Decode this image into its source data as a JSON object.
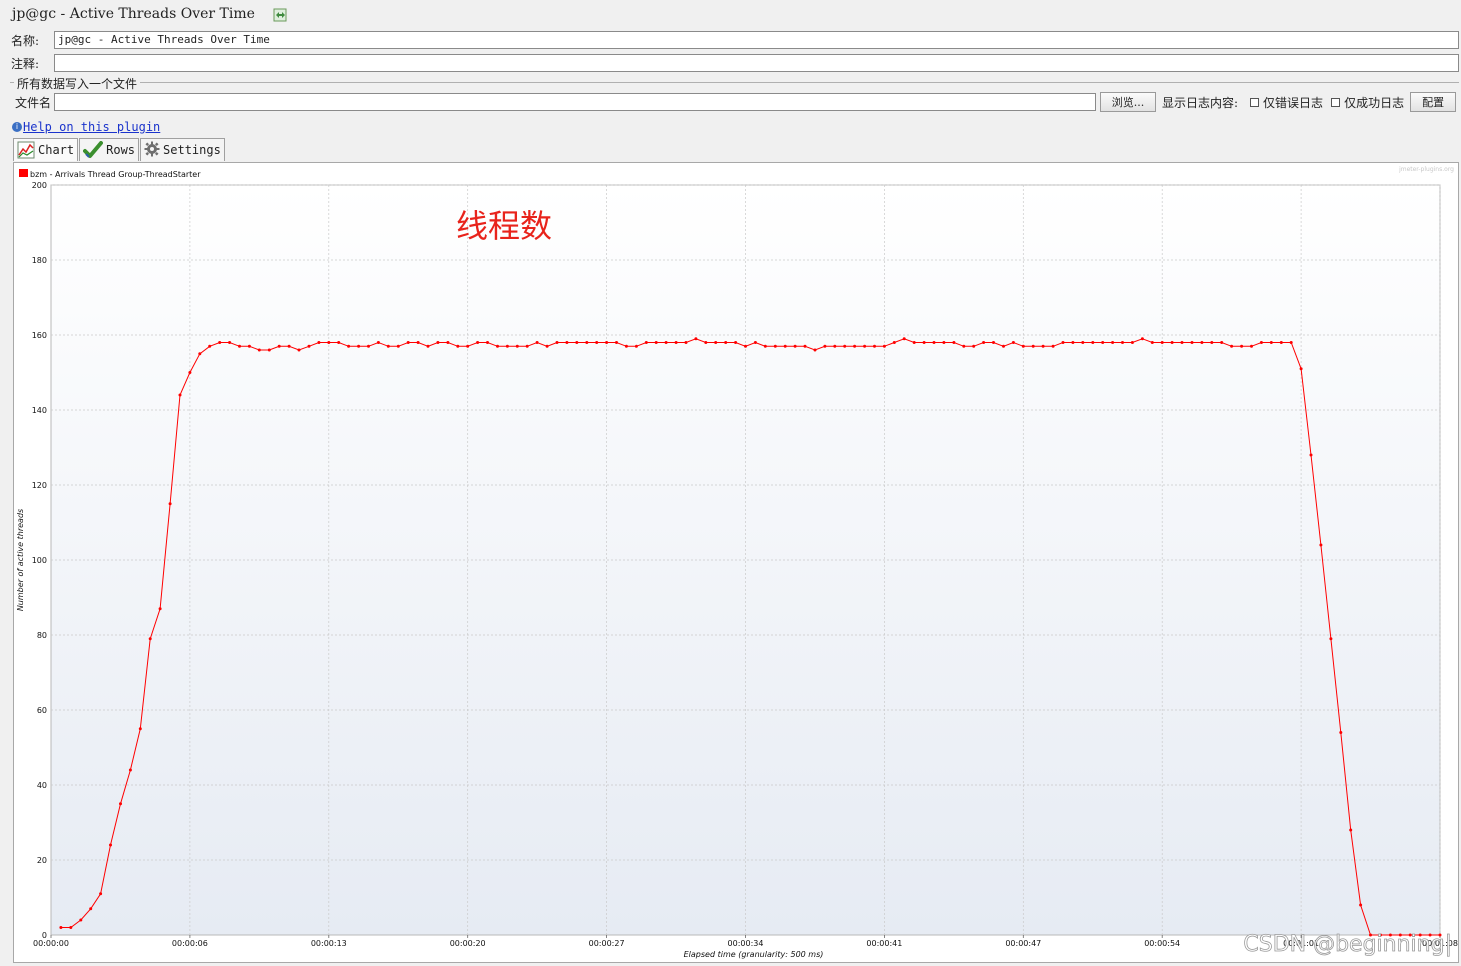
{
  "window": {
    "title": "jp@gc - Active Threads Over Time"
  },
  "form": {
    "name_label": "名称:",
    "name_value": "jp@gc - Active Threads Over Time",
    "comment_label": "注释:",
    "comment_value": ""
  },
  "file_group": {
    "legend": "所有数据写入一个文件",
    "filename_label": "文件名",
    "filename_value": "",
    "browse_button": "浏览...",
    "log_display_label": "显示日志内容:",
    "errors_only_label": "仅错误日志",
    "errors_only_checked": false,
    "success_only_label": "仅成功日志",
    "success_only_checked": false,
    "configure_button": "配置"
  },
  "help": {
    "link_text": "Help on this plugin"
  },
  "tabs": [
    {
      "label": "Chart",
      "icon": "line-chart-icon",
      "active": true
    },
    {
      "label": "Rows",
      "icon": "checkmark-icon",
      "active": false
    },
    {
      "label": "Settings",
      "icon": "gear-icon",
      "active": false
    }
  ],
  "annotation": {
    "text": "线程数",
    "color": "#e8231b"
  },
  "watermark": {
    "text": "CSDN @beginning|"
  },
  "chart_data": {
    "type": "line",
    "title": "",
    "watermark_small": "jmeter-plugins.org",
    "legend": [
      "bzm - Arrivals Thread Group-ThreadStarter"
    ],
    "legend_position": "top-left",
    "xlabel": "Elapsed time (granularity: 500 ms)",
    "ylabel": "Number of active threads",
    "ylim": [
      0,
      200
    ],
    "xlim_seconds": [
      0,
      70
    ],
    "y_ticks": [
      "0",
      "20",
      "40",
      "60",
      "80",
      "100",
      "120",
      "140",
      "160",
      "180",
      "200"
    ],
    "x_ticks": [
      "00:00:00",
      "00:00:06",
      "00:00:13",
      "00:00:20",
      "00:00:27",
      "00:00:34",
      "00:00:41",
      "00:00:47",
      "00:00:54",
      "00:01:01",
      "00:01:08"
    ],
    "grid": true,
    "series_color": "#ff0000",
    "series": [
      {
        "name": "bzm - Arrivals Thread Group-ThreadStarter",
        "x_seconds": [
          0.5,
          1,
          1.5,
          2,
          2.5,
          3,
          3.5,
          4,
          4.5,
          5,
          5.5,
          6,
          6.5,
          7,
          7.5,
          8,
          8.5,
          9,
          9.5,
          10,
          10.5,
          11,
          11.5,
          12,
          12.5,
          13,
          13.5,
          14,
          14.5,
          15,
          15.5,
          16,
          16.5,
          17,
          17.5,
          18,
          18.5,
          19,
          19.5,
          20,
          20.5,
          21,
          21.5,
          22,
          22.5,
          23,
          23.5,
          24,
          24.5,
          25,
          25.5,
          26,
          26.5,
          27,
          27.5,
          28,
          28.5,
          29,
          29.5,
          30,
          30.5,
          31,
          31.5,
          32,
          32.5,
          33,
          33.5,
          34,
          34.5,
          35,
          35.5,
          36,
          36.5,
          37,
          37.5,
          38,
          38.5,
          39,
          39.5,
          40,
          40.5,
          41,
          41.5,
          42,
          42.5,
          43,
          43.5,
          44,
          44.5,
          45,
          45.5,
          46,
          46.5,
          47,
          47.5,
          48,
          48.5,
          49,
          49.5,
          50,
          50.5,
          51,
          51.5,
          52,
          52.5,
          53,
          53.5,
          54,
          54.5,
          55,
          55.5,
          56,
          56.5,
          57,
          57.5,
          58,
          58.5,
          59,
          59.5,
          60,
          60.5,
          61,
          61.5,
          62,
          62.5,
          63,
          63.5,
          64,
          64.5,
          65,
          65.5,
          66,
          66.5,
          67,
          67.5,
          68,
          68.5,
          69,
          69.5,
          70
        ],
        "values": [
          2,
          2,
          4,
          7,
          11,
          24,
          35,
          44,
          55,
          79,
          87,
          115,
          144,
          150,
          155,
          157,
          158,
          158,
          157,
          157,
          156,
          156,
          157,
          157,
          156,
          157,
          158,
          158,
          158,
          157,
          157,
          157,
          158,
          157,
          157,
          158,
          158,
          157,
          158,
          158,
          157,
          157,
          158,
          158,
          157,
          157,
          157,
          157,
          158,
          157,
          158,
          158,
          158,
          158,
          158,
          158,
          158,
          157,
          157,
          158,
          158,
          158,
          158,
          158,
          159,
          158,
          158,
          158,
          158,
          157,
          158,
          157,
          157,
          157,
          157,
          157,
          156,
          157,
          157,
          157,
          157,
          157,
          157,
          157,
          158,
          159,
          158,
          158,
          158,
          158,
          158,
          157,
          157,
          158,
          158,
          157,
          158,
          157,
          157,
          157,
          157,
          158,
          158,
          158,
          158,
          158,
          158,
          158,
          158,
          159,
          158,
          158,
          158,
          158,
          158,
          158,
          158,
          158,
          157,
          157,
          157,
          158,
          158,
          158,
          158,
          151,
          128,
          104,
          79,
          54,
          28,
          8,
          0,
          0,
          0,
          0,
          0,
          0,
          0,
          0
        ]
      }
    ]
  }
}
